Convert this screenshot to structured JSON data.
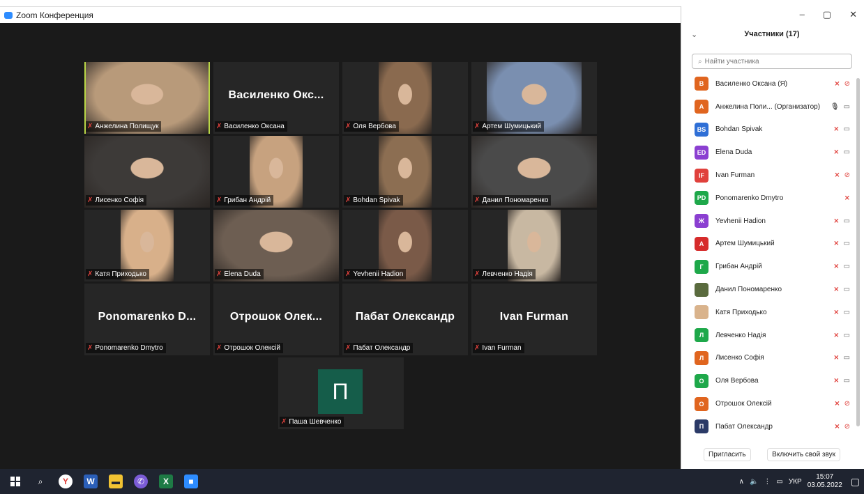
{
  "window": {
    "title": "Zoom Конференция"
  },
  "grid": [
    {
      "name": "Анжелина Полищук",
      "big_name": "",
      "video": true,
      "active": true
    },
    {
      "name": "Василенко Оксана",
      "big_name": "Василенко Окс...",
      "video": false,
      "active": false
    },
    {
      "name": "Оля Вербова",
      "big_name": "",
      "video": true,
      "active": false
    },
    {
      "name": "Артем Шумицький",
      "big_name": "",
      "video": true,
      "active": false
    },
    {
      "name": "Лисенко Софія",
      "big_name": "",
      "video": true,
      "active": false
    },
    {
      "name": "Грибан Андрій",
      "big_name": "",
      "video": true,
      "active": false
    },
    {
      "name": "Bohdan Spivak",
      "big_name": "",
      "video": true,
      "active": false
    },
    {
      "name": "Данил Пономаренко",
      "big_name": "",
      "video": true,
      "active": false
    },
    {
      "name": "Катя Приходько",
      "big_name": "",
      "video": true,
      "active": false
    },
    {
      "name": "Elena Duda",
      "big_name": "",
      "video": true,
      "active": false
    },
    {
      "name": "Yevhenii Hadion",
      "big_name": "",
      "video": true,
      "active": false
    },
    {
      "name": "Левченко Надія",
      "big_name": "",
      "video": true,
      "active": false
    },
    {
      "name": "Ponomarenko Dmytro",
      "big_name": "Ponomarenko D...",
      "video": false,
      "active": false
    },
    {
      "name": "Отрошок Олексій",
      "big_name": "Отрошок Олек...",
      "video": false,
      "active": false
    },
    {
      "name": "Пабат Олександр",
      "big_name": "Пабат Олександр",
      "video": false,
      "active": false
    },
    {
      "name": "Ivan Furman",
      "big_name": "Ivan Furman",
      "video": false,
      "active": false
    },
    {
      "name": "Паша Шевченко",
      "big_name": "П",
      "video": false,
      "active": false
    }
  ],
  "participants_panel": {
    "title": "Участники (17)",
    "search_placeholder": "Найти участника",
    "participants": [
      {
        "initials": "В",
        "color": "#e0651f",
        "name": "Василенко Оксана (Я)",
        "mic": "off",
        "cam": "off"
      },
      {
        "initials": "А",
        "color": "#e0651f",
        "name": "Анжелина Поли... (Организатор)",
        "mic": "on",
        "cam": "on"
      },
      {
        "initials": "BS",
        "color": "#2f6fd6",
        "name": "Bohdan Spivak",
        "mic": "off",
        "cam": "on"
      },
      {
        "initials": "ED",
        "color": "#8b3fd1",
        "name": "Elena Duda",
        "mic": "off",
        "cam": "on"
      },
      {
        "initials": "IF",
        "color": "#e0413c",
        "name": "Ivan Furman",
        "mic": "off",
        "cam": "off"
      },
      {
        "initials": "PD",
        "color": "#1ea84a",
        "name": "Ponomarenko Dmytro",
        "mic": "off",
        "cam": "none"
      },
      {
        "initials": "Ж",
        "color": "#8b3fd1",
        "name": "Yevhenii Hadion",
        "mic": "off",
        "cam": "on"
      },
      {
        "initials": "А",
        "color": "#d62b2b",
        "name": "Артем Шумицький",
        "mic": "off",
        "cam": "on"
      },
      {
        "initials": "Г",
        "color": "#1ea84a",
        "name": "Грибан Андрій",
        "mic": "off",
        "cam": "on"
      },
      {
        "initials": "",
        "color": "#5a6b3e",
        "name": "Данил Пономаренко",
        "mic": "off",
        "cam": "on"
      },
      {
        "initials": "",
        "color": "#d9b38c",
        "name": "Катя Приходько",
        "mic": "off",
        "cam": "on"
      },
      {
        "initials": "Л",
        "color": "#1ea84a",
        "name": "Левченко Надія",
        "mic": "off",
        "cam": "on"
      },
      {
        "initials": "Л",
        "color": "#e0651f",
        "name": "Лисенко Софія",
        "mic": "off",
        "cam": "on"
      },
      {
        "initials": "О",
        "color": "#1ea84a",
        "name": "Оля Вербова",
        "mic": "off",
        "cam": "on"
      },
      {
        "initials": "О",
        "color": "#e0651f",
        "name": "Отрошок Олексій",
        "mic": "off",
        "cam": "off"
      },
      {
        "initials": "П",
        "color": "#2b3a67",
        "name": "Пабат Олександр",
        "mic": "off",
        "cam": "off"
      }
    ],
    "invite_label": "Пригласить",
    "unmute_label": "Включить свой звук"
  },
  "taskbar": {
    "lang": "УКР",
    "time": "15:07",
    "date": "03.05.2022"
  }
}
